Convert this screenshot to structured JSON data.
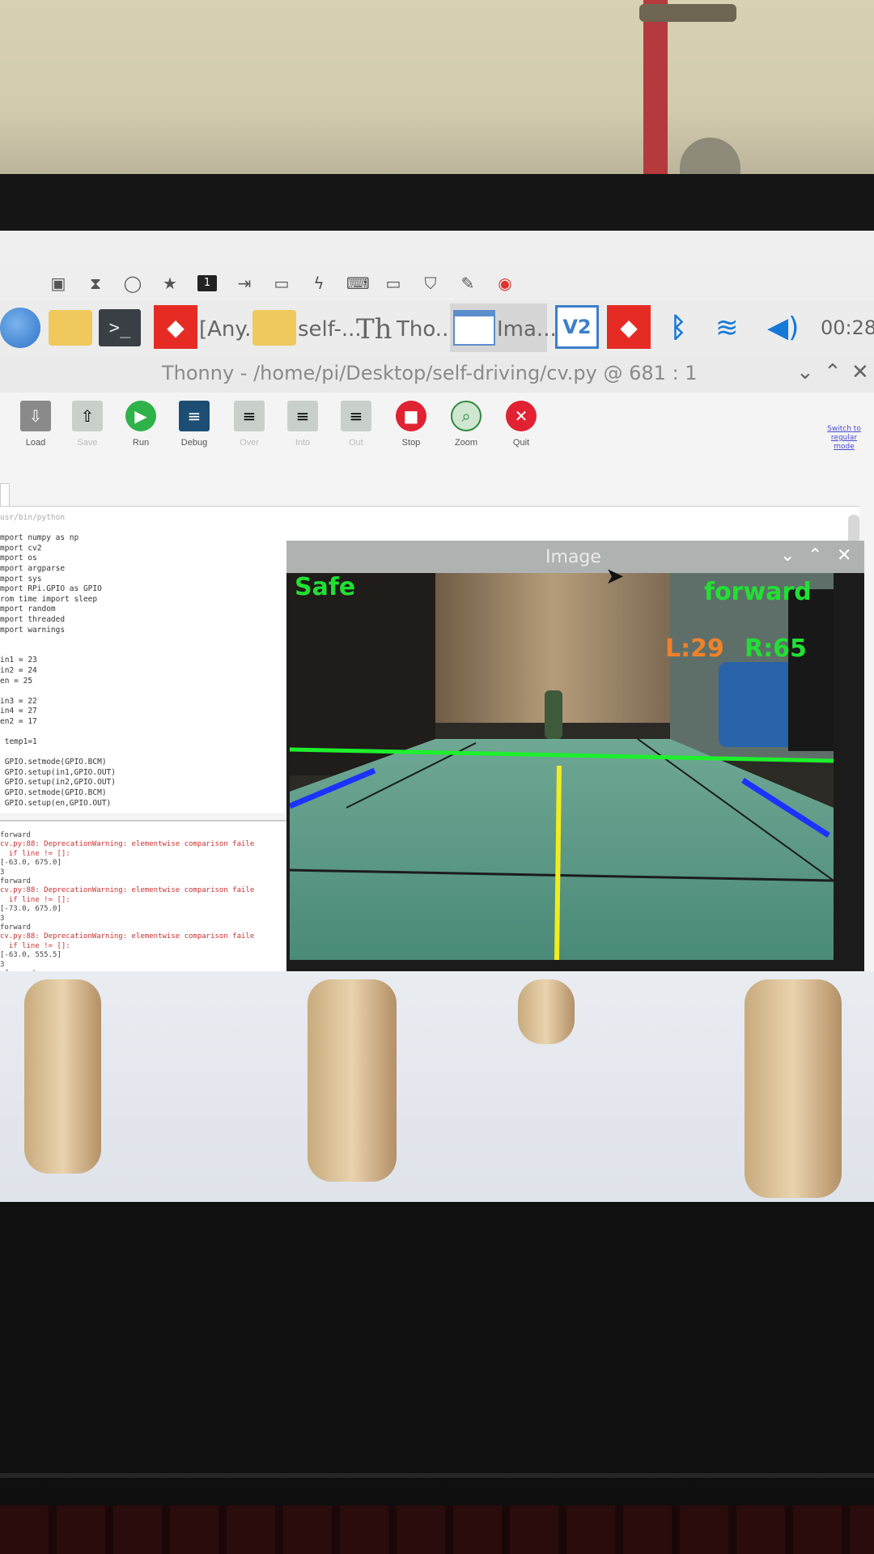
{
  "taskbar": {
    "items": [
      {
        "name": "anydesk",
        "label": "[Any..."
      },
      {
        "name": "file-manager",
        "label": "self-..."
      },
      {
        "name": "thonny",
        "label": "Tho..."
      },
      {
        "name": "image-window",
        "label": "Ima..."
      }
    ],
    "clock": "00:28"
  },
  "thonny": {
    "title": "Thonny - /home/pi/Desktop/self-driving/cv.py @ 681 : 1",
    "toolbar": [
      {
        "label": "Load",
        "enabled": true
      },
      {
        "label": "Save",
        "enabled": false
      },
      {
        "label": "Run",
        "enabled": true
      },
      {
        "label": "Debug",
        "enabled": true
      },
      {
        "label": "Over",
        "enabled": false
      },
      {
        "label": "Into",
        "enabled": false
      },
      {
        "label": "Out",
        "enabled": false
      },
      {
        "label": "Stop",
        "enabled": true
      },
      {
        "label": "Zoom",
        "enabled": true
      },
      {
        "label": "Quit",
        "enabled": true
      }
    ],
    "switch_mode": "Switch to regular mode",
    "code_lines": [
      "usr/bin/python",
      "",
      "mport numpy as np",
      "mport cv2",
      "mport os",
      "mport argparse",
      "mport sys",
      "mport RPi.GPIO as GPIO",
      "rom time import sleep",
      "mport random",
      "mport threaded",
      "mport warnings",
      "",
      "",
      "in1 = 23",
      "in2 = 24",
      "en = 25",
      "",
      "in3 = 22",
      "in4 = 27",
      "en2 = 17",
      "",
      " temp1=1",
      "",
      " GPIO.setmode(GPIO.BCM)",
      " GPIO.setup(in1,GPIO.OUT)",
      " GPIO.setup(in2,GPIO.OUT)",
      " GPIO.setmode(GPIO.BCM)",
      " GPIO.setup(en,GPIO.OUT)"
    ],
    "shell_lines": [
      "forward",
      "cv.py:88: DeprecationWarning: elementwise comparison faile",
      "  if line != []:",
      "[-63.0, 675.0]",
      "3",
      "forward",
      "cv.py:88: DeprecationWarning: elementwise comparison faile",
      "  if line != []:",
      "[-73.0, 675.0]",
      "3",
      "forward",
      "cv.py:88: DeprecationWarning: elementwise comparison faile",
      "  if line != []:",
      "[-63.0, 555.5]",
      "3",
      " forward"
    ]
  },
  "image_window": {
    "title": "Image",
    "status": "Safe",
    "direction": "forward",
    "left_reading": "L:29",
    "right_reading": "R:65"
  },
  "colors": {
    "status_green": "#22e033",
    "reading_orange": "#f0822a",
    "lane_blue": "#1a33ff",
    "center_yellow": "#f2ec1f",
    "horizon_green": "#1df02c",
    "taskbar_accent": "#1679d8"
  }
}
